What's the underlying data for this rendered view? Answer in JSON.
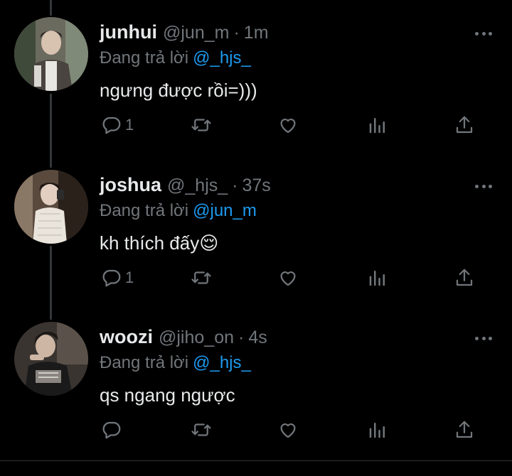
{
  "reply_prefix": "Đang trả lời",
  "colors": {
    "background": "#000000",
    "text": "#e7e9ea",
    "muted": "#71767b",
    "mention": "#1d9bf0",
    "thread_line": "#333639"
  },
  "icons": {
    "reply": "reply-icon",
    "retweet": "retweet-icon",
    "like": "heart-icon",
    "views": "analytics-icon",
    "share": "share-icon",
    "more": "more-icon"
  },
  "tweets": [
    {
      "name": "junhui",
      "handle": "@jun_m",
      "dot": "·",
      "time": "1m",
      "reply_to": "@_hjs_",
      "text": "ngưng được rồi=)))",
      "reply_count": "1"
    },
    {
      "name": "joshua",
      "handle": "@_hjs_",
      "dot": "·",
      "time": "37s",
      "reply_to": "@jun_m",
      "text": "kh thích đấy😌",
      "reply_count": "1"
    },
    {
      "name": "woozi",
      "handle": "@jiho_on",
      "dot": "·",
      "time": "4s",
      "reply_to": "@_hjs_",
      "text": "qs ngang ngược",
      "reply_count": ""
    }
  ]
}
